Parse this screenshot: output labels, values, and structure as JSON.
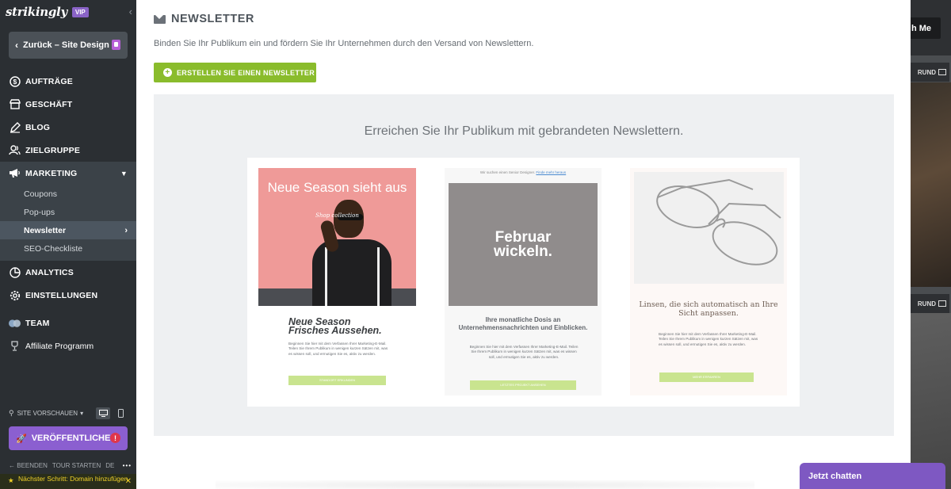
{
  "brand": {
    "logo": "strikingly",
    "badge": "VIP"
  },
  "sidebar": {
    "back_label": "Zurück – Site Design",
    "items": [
      {
        "label": "AUFTRÄGE",
        "icon": "dollar-circle-icon"
      },
      {
        "label": "GESCHÄFT",
        "icon": "store-icon"
      },
      {
        "label": "BLOG",
        "icon": "pen-icon"
      },
      {
        "label": "ZIELGRUPPE",
        "icon": "people-icon"
      },
      {
        "label": "MARKETING",
        "icon": "megaphone-icon"
      },
      {
        "label": "ANALYTICS",
        "icon": "pie-chart-icon"
      },
      {
        "label": "EINSTELLUNGEN",
        "icon": "gear-icon"
      },
      {
        "label": "TEAM",
        "icon": "team-icon"
      },
      {
        "label": "Affiliate Programm",
        "icon": "trophy-icon"
      }
    ],
    "marketing_sub": [
      "Coupons",
      "Pop-ups",
      "Newsletter",
      "SEO-Checkliste"
    ],
    "preview_label": "SITE VORSCHAUEN",
    "publish_label": "VERÖFFENTLICHEN",
    "footer": {
      "exit": "BEENDEN",
      "tour": "TOUR STARTEN",
      "lang": "DE",
      "more": "•••"
    },
    "next_step": "Nächster Schritt: Domain hinzufügen"
  },
  "panel": {
    "title": "NEWSLETTER",
    "description": "Binden Sie Ihr Publikum ein und fördern Sie Ihr Unternehmen durch den Versand von Newslettern.",
    "create_button": "ERSTELLEN SIE EINEN NEWSLETTER",
    "promo_title": "Erreichen Sie Ihr Publikum mit gebrandeten Newslettern."
  },
  "cards": {
    "card1": {
      "headline": "Neue Season sieht aus",
      "sub": "Shop collection",
      "title_line1": "Neue Season",
      "title_line2": "Frisches Aussehen.",
      "text": "Beginnen Sie hier mit dem Verfassen Ihrer Marketing-E-Mail. Teilen Sie Ihrem Publikum in wenigen kurzen Sätzen mit, was es wissen soll, und ermutigen Sie es, aktiv zu werden.",
      "button": "STANDORT ERKUNDEN"
    },
    "card2": {
      "top_text": "Wir suchen einen Senior Designer.",
      "top_link": "Finde mehr heraus",
      "big_line1": "Februar",
      "big_line2": "wickeln.",
      "title": "Ihre monatliche Dosis an Unternehmensnachrichten und Einblicken.",
      "text": "Beginnen Sie hier mit dem Verfassen Ihrer Marketing-E-Mail. Teilen Sie Ihrem Publikum in wenigen kurzen Sätzen mit, was es wissen soll, und ermutigen Sie es, aktiv zu werden.",
      "button": "LETZTES PROJEKT ANSEHEN"
    },
    "card3": {
      "title": "Linsen, die sich automatisch an Ihre Sicht anpassen.",
      "text": "Beginnen Sie hier mit dem Verfassen Ihrer Marketing-E-Mail. Teilen Sie Ihrem Publikum in wenigen kurzen Sätzen mit, was es wissen soll, und ermutigen Sie es, aktiv zu werden.",
      "button": "MEHR ERFAHREN"
    }
  },
  "site_bg": {
    "button": "h Me",
    "tag": "RUND"
  },
  "chat": {
    "label": "Jetzt chatten"
  },
  "colors": {
    "accent_green": "#8abc2c",
    "publish_purple": "#8b5fd0",
    "sidebar_bg": "#2b2f33",
    "chat_purple": "#7e58c2"
  }
}
